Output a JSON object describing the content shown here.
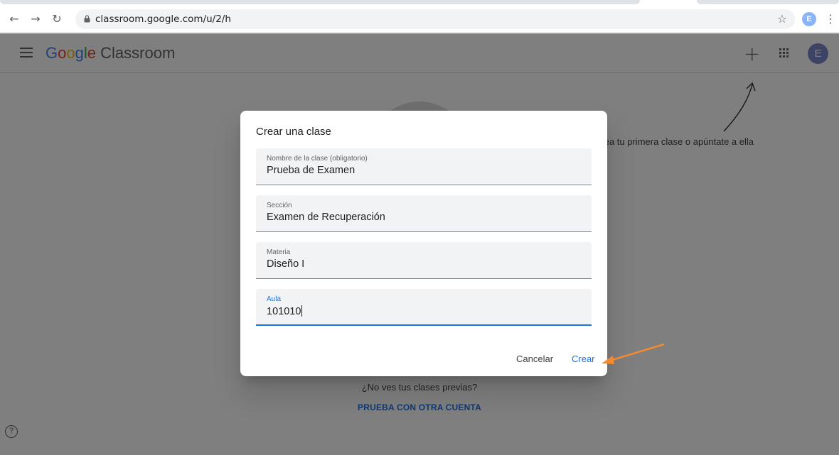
{
  "browser": {
    "url": "classroom.google.com/u/2/h",
    "profile_initial": "E",
    "icons": [
      "back-arrow-icon",
      "forward-arrow-icon",
      "reload-icon",
      "lock-icon",
      "star-icon",
      "kebab-menu-icon"
    ]
  },
  "app": {
    "brand_google": [
      "G",
      "o",
      "o",
      "g",
      "l",
      "e"
    ],
    "brand_product": "Classroom",
    "avatar_initial": "E",
    "empty_hint": "Crea tu primera clase o apúntate a ella",
    "no_see_text": "¿No ves tus clases previas?",
    "other_account": "PRUEBA CON OTRA CUENTA",
    "help_glyph": "?"
  },
  "dialog": {
    "title": "Crear una clase",
    "fields": [
      {
        "label": "Nombre de la clase (obligatorio)",
        "value": "Prueba de Examen"
      },
      {
        "label": "Sección",
        "value": "Examen de Recuperación"
      },
      {
        "label": "Materia",
        "value": "Diseño I"
      },
      {
        "label": "Aula",
        "value": "101010"
      }
    ],
    "cancel_label": "Cancelar",
    "create_label": "Crear"
  },
  "colors": {
    "accent": "#1a73e8",
    "annotation_arrow": "#f28b30"
  }
}
